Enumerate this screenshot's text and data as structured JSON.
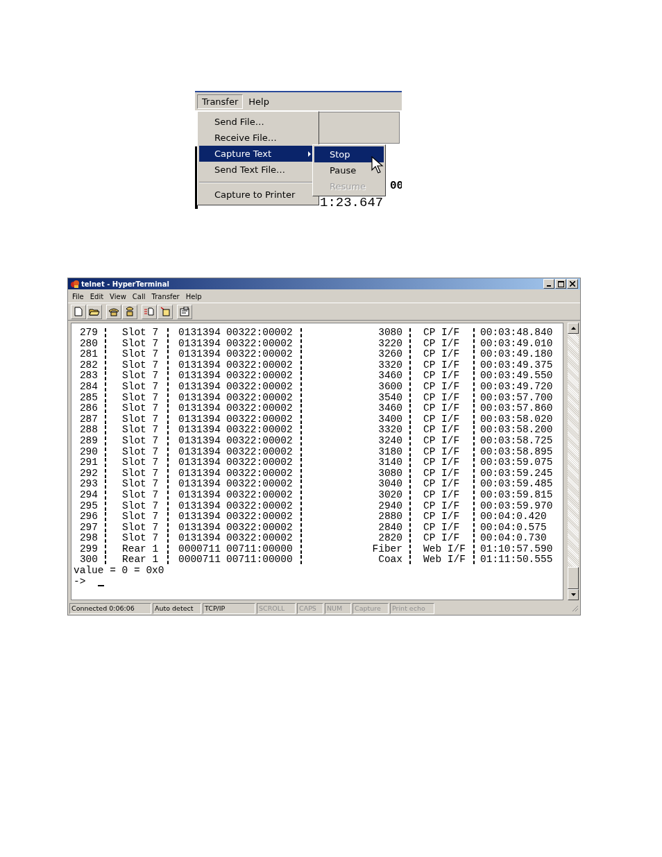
{
  "menu_figure": {
    "menu_bar": [
      {
        "label": "Transfer",
        "selected": true
      },
      {
        "label": "Help",
        "selected": false
      }
    ],
    "menu": [
      {
        "label": "Send File…",
        "selected": false,
        "has_submenu": false,
        "separator_before": false
      },
      {
        "label": "Receive File…",
        "selected": false,
        "has_submenu": false,
        "separator_before": false
      },
      {
        "label": "Capture Text",
        "selected": true,
        "has_submenu": true,
        "separator_before": false
      },
      {
        "label": "Send Text File…",
        "selected": false,
        "has_submenu": false,
        "separator_before": false
      },
      {
        "label": "Capture to Printer",
        "selected": false,
        "has_submenu": false,
        "separator_before": true
      }
    ],
    "submenu": [
      {
        "label": "Stop",
        "selected": true,
        "disabled": false
      },
      {
        "label": "Pause",
        "selected": false,
        "disabled": false
      },
      {
        "label": "Resume",
        "selected": false,
        "disabled": true
      }
    ],
    "background_text": [
      "00",
      "1:23.647"
    ]
  },
  "terminal_window": {
    "title": "telnet - HyperTerminal",
    "menu_bar": [
      "File",
      "Edit",
      "View",
      "Call",
      "Transfer",
      "Help"
    ],
    "rows": [
      {
        "num": "279",
        "source": "Slot 7",
        "id": "0131394",
        "port": "00322:00002",
        "value": "3080",
        "iface": "CP I/F",
        "time": "00:03:48.840"
      },
      {
        "num": "280",
        "source": "Slot 7",
        "id": "0131394",
        "port": "00322:00002",
        "value": "3220",
        "iface": "CP I/F",
        "time": "00:03:49.010"
      },
      {
        "num": "281",
        "source": "Slot 7",
        "id": "0131394",
        "port": "00322:00002",
        "value": "3260",
        "iface": "CP I/F",
        "time": "00:03:49.180"
      },
      {
        "num": "282",
        "source": "Slot 7",
        "id": "0131394",
        "port": "00322:00002",
        "value": "3320",
        "iface": "CP I/F",
        "time": "00:03:49.375"
      },
      {
        "num": "283",
        "source": "Slot 7",
        "id": "0131394",
        "port": "00322:00002",
        "value": "3460",
        "iface": "CP I/F",
        "time": "00:03:49.550"
      },
      {
        "num": "284",
        "source": "Slot 7",
        "id": "0131394",
        "port": "00322:00002",
        "value": "3600",
        "iface": "CP I/F",
        "time": "00:03:49.720"
      },
      {
        "num": "285",
        "source": "Slot 7",
        "id": "0131394",
        "port": "00322:00002",
        "value": "3540",
        "iface": "CP I/F",
        "time": "00:03:57.700"
      },
      {
        "num": "286",
        "source": "Slot 7",
        "id": "0131394",
        "port": "00322:00002",
        "value": "3460",
        "iface": "CP I/F",
        "time": "00:03:57.860"
      },
      {
        "num": "287",
        "source": "Slot 7",
        "id": "0131394",
        "port": "00322:00002",
        "value": "3400",
        "iface": "CP I/F",
        "time": "00:03:58.020"
      },
      {
        "num": "288",
        "source": "Slot 7",
        "id": "0131394",
        "port": "00322:00002",
        "value": "3320",
        "iface": "CP I/F",
        "time": "00:03:58.200"
      },
      {
        "num": "289",
        "source": "Slot 7",
        "id": "0131394",
        "port": "00322:00002",
        "value": "3240",
        "iface": "CP I/F",
        "time": "00:03:58.725"
      },
      {
        "num": "290",
        "source": "Slot 7",
        "id": "0131394",
        "port": "00322:00002",
        "value": "3180",
        "iface": "CP I/F",
        "time": "00:03:58.895"
      },
      {
        "num": "291",
        "source": "Slot 7",
        "id": "0131394",
        "port": "00322:00002",
        "value": "3140",
        "iface": "CP I/F",
        "time": "00:03:59.075"
      },
      {
        "num": "292",
        "source": "Slot 7",
        "id": "0131394",
        "port": "00322:00002",
        "value": "3080",
        "iface": "CP I/F",
        "time": "00:03:59.245"
      },
      {
        "num": "293",
        "source": "Slot 7",
        "id": "0131394",
        "port": "00322:00002",
        "value": "3040",
        "iface": "CP I/F",
        "time": "00:03:59.485"
      },
      {
        "num": "294",
        "source": "Slot 7",
        "id": "0131394",
        "port": "00322:00002",
        "value": "3020",
        "iface": "CP I/F",
        "time": "00:03:59.815"
      },
      {
        "num": "295",
        "source": "Slot 7",
        "id": "0131394",
        "port": "00322:00002",
        "value": "2940",
        "iface": "CP I/F",
        "time": "00:03:59.970"
      },
      {
        "num": "296",
        "source": "Slot 7",
        "id": "0131394",
        "port": "00322:00002",
        "value": "2880",
        "iface": "CP I/F",
        "time": "00:04:0.420"
      },
      {
        "num": "297",
        "source": "Slot 7",
        "id": "0131394",
        "port": "00322:00002",
        "value": "2840",
        "iface": "CP I/F",
        "time": "00:04:0.575"
      },
      {
        "num": "298",
        "source": "Slot 7",
        "id": "0131394",
        "port": "00322:00002",
        "value": "2820",
        "iface": "CP I/F",
        "time": "00:04:0.730"
      },
      {
        "num": "299",
        "source": "Rear 1",
        "id": "0000711",
        "port": "00711:00000",
        "value": "Fiber",
        "iface": "Web I/F",
        "time": "01:10:57.590"
      },
      {
        "num": "300",
        "source": "Rear 1",
        "id": "0000711",
        "port": "00711:00000",
        "value": "Coax",
        "iface": "Web I/F",
        "time": "01:11:50.555"
      }
    ],
    "output": "value = 0 = 0x0",
    "prompt": "->",
    "status_bar": [
      {
        "label": "Connected 0:06:06",
        "disabled": false
      },
      {
        "label": "Auto detect",
        "disabled": false
      },
      {
        "label": "TCP/IP",
        "disabled": false
      },
      {
        "label": "SCROLL",
        "disabled": true
      },
      {
        "label": "CAPS",
        "disabled": true
      },
      {
        "label": "NUM",
        "disabled": true
      },
      {
        "label": "Capture",
        "disabled": true
      },
      {
        "label": "Print echo",
        "disabled": true
      }
    ]
  }
}
